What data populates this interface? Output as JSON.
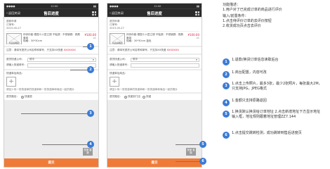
{
  "phone": {
    "status_left": "●●●●",
    "status_time": "12:00",
    "status_right": "▮▮",
    "back_label": "返回关闭",
    "title": "售后进度"
  },
  "left": {
    "order_line1": "退款申请",
    "order_line2": "订单号：",
    "order_line3": "2015-05-27",
    "product_name": "伴你你能·德国十六层立锅 不粘锅 · 不锈钢锅 · 锅具套组",
    "product_spec": "规格：30*30cm",
    "thumb_caption": "商品缩略图",
    "price": "¥100.00",
    "qty": "x1",
    "notice_text": "注意：请填写退货公司名称和单号，只支持XX快递",
    "notice_red": "XXXXXXX",
    "courier_label": "退货快递公司：",
    "courier_value": "顺丰",
    "tracking_label": "请输入快递单号：",
    "photo_label": "快递单及商品：",
    "photo_hint": "请至少传一张快递单的快递单和一张快递单和商品一起的照片",
    "delivery_label": "退货路径：",
    "delivery_option": "快递退",
    "float_btn": "快速 客服",
    "confirm": "提交"
  },
  "right": {
    "order_line1": "退货申请",
    "order_line2": "订单号：",
    "order_line3": "2015-05-27",
    "product_name": "伴你你能·德国十六层立锅 不粘锅 · 不锈钢锅 · 锅具套组",
    "product_spec": "规格：30*30cm 蓝色",
    "thumb_caption": "商品缩略图",
    "price": "¥100.00",
    "qty": "x1",
    "notice_text": "注意：请填写退货公司名称和单号，只支持XX快递",
    "notice_red": "XXXXXXX",
    "courier_label": "退货快递公司：",
    "courier_value": "顺丰",
    "tracking_label": "请输入快递单号：",
    "photo_label": "快递单及商品：",
    "photo_hint": "请至少传一张快递单的快递单和一张快递单和商品一起的照片",
    "delivery_label": "退货路径：",
    "delivery_option_1": "快递到门店",
    "delivery_option_2": "快递",
    "float_btn": "快速 客服",
    "confirm": "提交"
  },
  "callouts_left": [
    "1",
    "2",
    "3",
    "4"
  ],
  "callouts_right": [
    "5",
    "6"
  ],
  "spec": {
    "title": "功能描述：",
    "desc": "1.用户对了已完成订单的商品进行评价",
    "io_title": "输入/前置条件：",
    "io_1": "1.点击待评价订单的去评价按钮",
    "io_2": "2.收货成功页点击去评价",
    "items": [
      {
        "n": "1",
        "text": "1.退款/换货订单信息读取后台"
      },
      {
        "n": "2",
        "text": "1.商台配置，内容可改"
      },
      {
        "n": "3",
        "text": "1.点击上传照片，最多3张，最少2张照片，每张最大2M，只支持JPG，JPEG格式"
      },
      {
        "n": "4",
        "text": "1.金额只支持原路退回"
      },
      {
        "n": "5",
        "text": "1.换货默认换货给订单地址 2.点击新增地址下方显示地址输入框，地址规则跟着地址管理ZZ7.144"
      },
      {
        "n": "6",
        "text": "1.点击提交跳转检测，成功跳转到售后进度页"
      }
    ]
  },
  "colors": {
    "accent": "#3a7bd5",
    "confirm": "#f07b38",
    "price": "#dd2244",
    "navbar": "#2b2b2b"
  }
}
